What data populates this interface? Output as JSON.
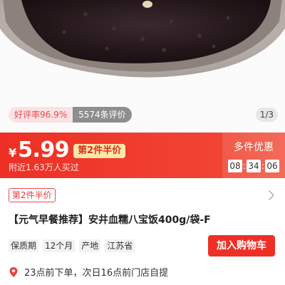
{
  "product_image": {
    "description_icon": "rice-bowl-photo"
  },
  "rating": {
    "good_rate": "好评率96.9%",
    "review_count": "5574条评价"
  },
  "gallery": {
    "page_indicator": "1/3"
  },
  "price": {
    "currency": "¥",
    "amount": "5.99",
    "promo": "第2件半价",
    "buyers": "附近1.63万人买过"
  },
  "deal": {
    "title": "多件优惠",
    "countdown": [
      "08",
      "34",
      "06"
    ],
    "separator": ":"
  },
  "promo_line": {
    "label": "第2件半价"
  },
  "product": {
    "title": "【元气早餐推荐】安井血糯八宝饭400g/袋-F"
  },
  "specs": [
    {
      "key": "保质期",
      "value": "12个月"
    },
    {
      "key": "产地",
      "value": "江苏省"
    }
  ],
  "cart": {
    "button_label": "加入购物车"
  },
  "pickup": {
    "text": "23点前下单，次日16点前门店自提"
  },
  "colors": {
    "accent": "#ee2f25",
    "promo_yellow": "#fde7a6",
    "rating_pink": "#fbe2e3"
  }
}
